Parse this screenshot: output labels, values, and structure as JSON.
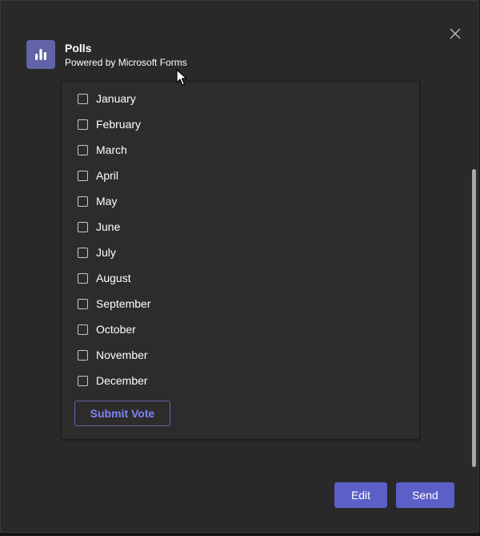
{
  "app": {
    "title": "Polls",
    "subtitle": "Powered by Microsoft Forms",
    "icon": "bar-chart-icon"
  },
  "poll": {
    "options": [
      {
        "label": "January",
        "checked": false
      },
      {
        "label": "February",
        "checked": false
      },
      {
        "label": "March",
        "checked": false
      },
      {
        "label": "April",
        "checked": false
      },
      {
        "label": "May",
        "checked": false
      },
      {
        "label": "June",
        "checked": false
      },
      {
        "label": "July",
        "checked": false
      },
      {
        "label": "August",
        "checked": false
      },
      {
        "label": "September",
        "checked": false
      },
      {
        "label": "October",
        "checked": false
      },
      {
        "label": "November",
        "checked": false
      },
      {
        "label": "December",
        "checked": false
      }
    ],
    "submit_label": "Submit Vote"
  },
  "footer": {
    "edit_label": "Edit",
    "send_label": "Send"
  },
  "colors": {
    "accent": "#6264a7",
    "primary_button": "#5b5fc7",
    "submit_text": "#7f85f5",
    "dialog_bg": "#292929",
    "card_bg": "#2d2c2c"
  }
}
